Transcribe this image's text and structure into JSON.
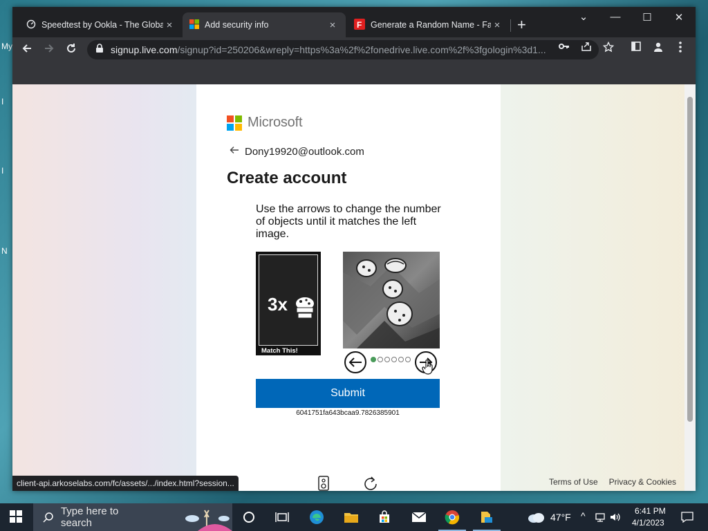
{
  "desktop": {
    "edge_letters": [
      "My",
      "I",
      "I",
      "N"
    ]
  },
  "tabs": [
    {
      "title": "Speedtest by Ookla - The Global",
      "icon": "speedometer-icon",
      "active": false
    },
    {
      "title": "Add security info",
      "icon": "microsoft-logo-icon",
      "active": true
    },
    {
      "title": "Generate a Random Name - Fak",
      "icon": "fakename-logo-icon",
      "active": false
    }
  ],
  "window_controls": {
    "tab_search": "⌄",
    "minimize": "—",
    "maximize": "☐",
    "close": "✕"
  },
  "newtab_label": "+",
  "address_bar": {
    "host": "signup.live.com",
    "path": "/signup?id=250206&wreply=https%3a%2f%2fonedrive.live.com%2f%3fgologin%3d1..."
  },
  "page": {
    "brand": "Microsoft",
    "back_email": "Dony19920@outlook.com",
    "title": "Create account",
    "captcha": {
      "instruction": "Use the arrows to change the number of objects until it matches the left image.",
      "match_count": "3x",
      "match_label": "Match This!",
      "progress": {
        "total": 6,
        "current": 1
      },
      "submit_label": "Submit",
      "session_id": "6041751fa643bcaa9.7826385901"
    },
    "footer": {
      "terms": "Terms of Use",
      "privacy": "Privacy & Cookies"
    }
  },
  "status_url": "client-api.arkoselabs.com/fc/assets/.../index.html?session...",
  "taskbar": {
    "search_placeholder": "Type here to search",
    "weather": "47°F",
    "time": "6:41 PM",
    "date": "4/1/2023"
  },
  "colors": {
    "submit_bg": "#0067b8",
    "ms_red": "#f25022",
    "ms_green": "#7fba00",
    "ms_blue": "#00a4ef",
    "ms_yellow": "#ffb900",
    "chrome_dark": "#202124",
    "chrome_toolbar": "#35363a"
  }
}
